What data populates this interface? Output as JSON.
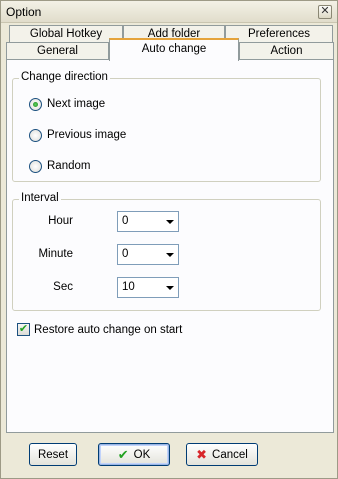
{
  "window": {
    "title": "Option",
    "close_glyph": "✕"
  },
  "tabs_back": [
    {
      "label": "Global Hotkey"
    },
    {
      "label": "Add folder"
    },
    {
      "label": "Preferences"
    }
  ],
  "tabs_front": [
    {
      "label": "General"
    },
    {
      "label": "Auto change"
    },
    {
      "label": "Action"
    }
  ],
  "active_tab": "Auto change",
  "change_direction": {
    "title": "Change direction",
    "options": [
      {
        "label": "Next image",
        "checked": true
      },
      {
        "label": "Previous image",
        "checked": false
      },
      {
        "label": "Random",
        "checked": false
      }
    ]
  },
  "interval": {
    "title": "Interval",
    "fields": [
      {
        "label": "Hour",
        "value": "0"
      },
      {
        "label": "Minute",
        "value": "0"
      },
      {
        "label": "Sec",
        "value": "10"
      }
    ]
  },
  "restore": {
    "label": "Restore auto change on start",
    "checked": true,
    "check_glyph": "✔"
  },
  "buttons": {
    "reset": "Reset",
    "ok": "OK",
    "ok_icon": "✔",
    "cancel": "Cancel",
    "cancel_icon": "✖"
  },
  "colors": {
    "accent_tab": "#e5a33a",
    "ok_green": "#21a121",
    "cancel_red": "#d8262b"
  }
}
